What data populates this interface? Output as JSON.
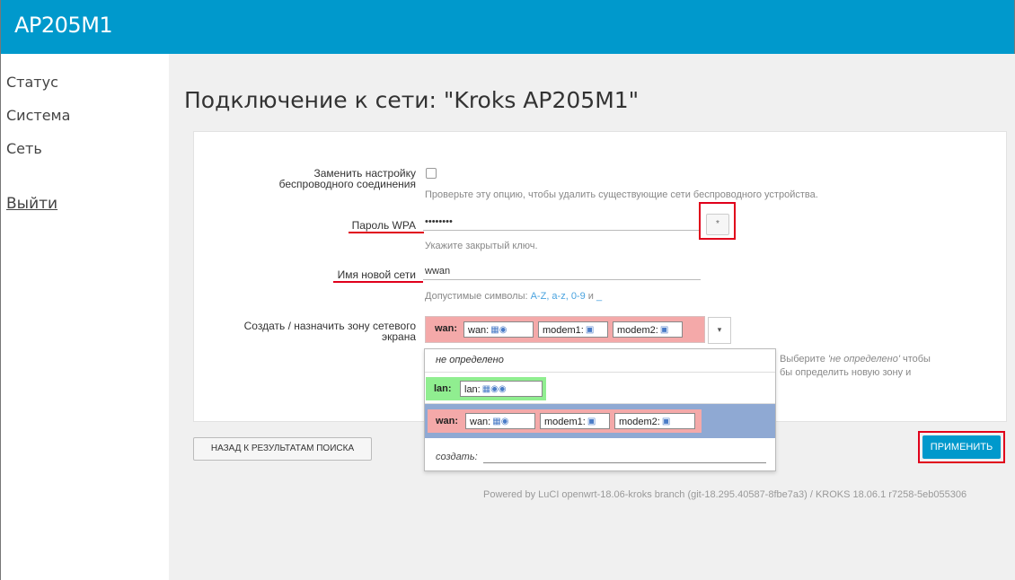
{
  "app": {
    "title": "AP205M1"
  },
  "sidebar": {
    "items": [
      {
        "label": "Статус"
      },
      {
        "label": "Система"
      },
      {
        "label": "Сеть"
      }
    ],
    "logout_label": "Выйти"
  },
  "main": {
    "title": "Подключение к сети: \"Kroks AP205M1\""
  },
  "form": {
    "replace": {
      "label_line1": "Заменить настройку",
      "label_line2": "беспроводного соединения",
      "hint": "Проверьте эту опцию, чтобы удалить существующие сети беспроводного устройства."
    },
    "wpa": {
      "label": "Пароль WPA",
      "value": "••••••••",
      "reveal_icon": "*",
      "hint": "Укажите закрытый ключ."
    },
    "ssid": {
      "label": "Имя новой сети",
      "value": "wwan",
      "hint_prefix": "Допустимые символы: ",
      "hint_chars": "A-Z, a-z, 0-9",
      "hint_and": " и ",
      "hint_underscore": "_"
    },
    "zone": {
      "label_line1": "Создать / назначить зону сетевого",
      "label_line2": "экрана",
      "selected_zone": "wan:",
      "networks": [
        "wan:",
        "modem1:",
        "modem2:"
      ],
      "arrow": "▾",
      "hint_line1_a": "Выберите ",
      "hint_line1_em": "'не определено'",
      "hint_line1_b": " чтобы",
      "hint_line2": "бы определить новую зону и"
    }
  },
  "dropdown": {
    "undefined_label": "не определено",
    "lan": {
      "zone": "lan:",
      "network": "lan:"
    },
    "wan": {
      "zone": "wan:",
      "networks": [
        "wan:",
        "modem1:",
        "modem2:"
      ]
    },
    "create_label": "создать:"
  },
  "buttons": {
    "back": "НАЗАД К РЕЗУЛЬТАТАМ ПОИСКА",
    "apply": "ПРИМЕНИТЬ"
  },
  "footer": "Powered by LuCI openwrt-18.06-kroks branch (git-18.295.40587-8fbe7a3) / KROKS 18.06.1 r7258-5eb055306",
  "colors": {
    "header": "#0099cc",
    "wan_zone": "#f4a9a9",
    "lan_zone": "#90ee90",
    "highlight": "#8fa9d3",
    "annotation": "#e0001b"
  }
}
